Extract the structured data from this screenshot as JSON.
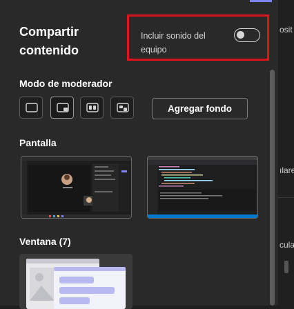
{
  "panel": {
    "title": "Compartir contenido",
    "sound": {
      "label": "Incluir sonido del equipo",
      "enabled": false
    },
    "presenter_mode": {
      "title": "Modo de moderador",
      "modes": [
        "content-only-icon",
        "standout-icon",
        "side-by-side-icon",
        "reporter-icon"
      ],
      "selected_index": 1,
      "background_button": "Agregar fondo"
    },
    "screen": {
      "title": "Pantalla",
      "count": 2
    },
    "window": {
      "title": "Ventana (7)"
    }
  },
  "right_strip": {
    "fragments": [
      "osit",
      "ılare",
      "culan"
    ]
  },
  "colors": {
    "accent": "#7f85f5",
    "highlight": "#e0141e",
    "panel_bg": "#292929"
  }
}
